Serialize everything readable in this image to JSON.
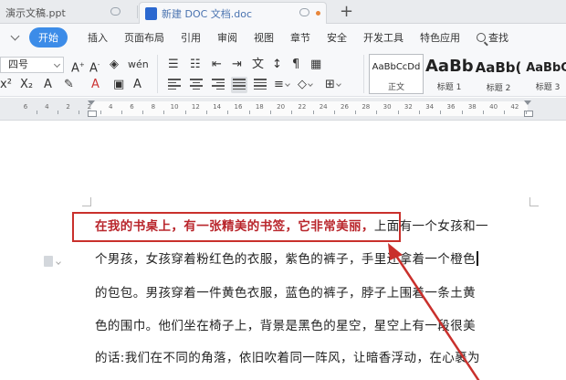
{
  "tabs": [
    {
      "label": "演示文稿.ppt",
      "icon": "presentation-file-icon"
    },
    {
      "label": "新建 DOC 文档.doc",
      "icon": "word-doc-icon"
    }
  ],
  "menu": {
    "items": [
      "开始",
      "插入",
      "页面布局",
      "引用",
      "审阅",
      "视图",
      "章节",
      "安全",
      "开发工具",
      "特色应用"
    ],
    "active": "开始",
    "search_label": "查找"
  },
  "ribbon": {
    "font_size": "四号",
    "styles": [
      {
        "sample": "AaBbCcDd",
        "name": "正文"
      },
      {
        "sample": "AaBb",
        "name": "标题 1"
      },
      {
        "sample": "AaBb(",
        "name": "标题 2"
      },
      {
        "sample": "AaBbC",
        "name": "标题 3"
      }
    ]
  },
  "ruler": {
    "numbers": [
      "6",
      "4",
      "2",
      "2",
      "4",
      "6",
      "8",
      "10",
      "12",
      "14",
      "16",
      "18",
      "20",
      "22",
      "24",
      "26",
      "28",
      "30",
      "32",
      "34",
      "36",
      "38",
      "40",
      "42"
    ]
  },
  "document": {
    "highlighted": "在我的书桌上，有一张精美的书签，它非常美丽，",
    "line1_rest": "上面有一个女孩和一",
    "lines": [
      "个男孩，女孩穿着粉红色的衣服，紫色的裤子，手里还拿着一个橙色",
      "的包包。男孩穿着一件黄色衣服，蓝色的裤子，脖子上围着一条土黄",
      "色的围巾。他们坐在椅子上，背景是黑色的星空，星空上有一段很美",
      "的话:我们在不同的角落，依旧吹着同一阵风，让暗香浮动，在心裹为"
    ]
  },
  "colors": {
    "accent": "#3c8ce8",
    "highlight_text": "#b9262c",
    "annotation": "#c9302c"
  }
}
